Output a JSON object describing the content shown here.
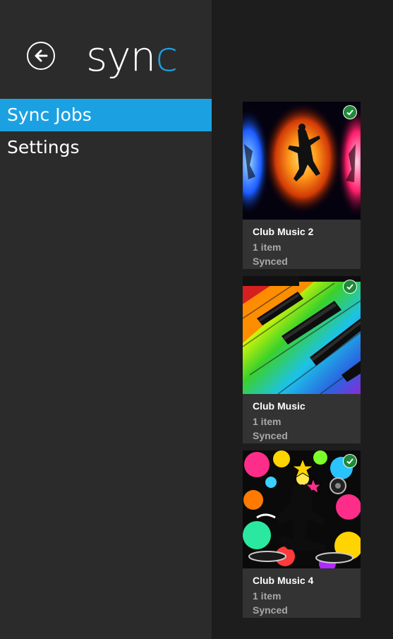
{
  "header": {
    "back_icon": "back-arrow-icon",
    "title_main": "syn",
    "title_accent": "c"
  },
  "nav": {
    "items": [
      {
        "label": "Sync Jobs",
        "selected": true
      },
      {
        "label": "Settings",
        "selected": false
      }
    ]
  },
  "jobs": [
    {
      "title": "Club Music 2",
      "count": "1 item",
      "status": "Synced",
      "image": "dancer-fire-image",
      "badge": "check-icon"
    },
    {
      "title": "Club Music",
      "count": "1 item",
      "status": "Synced",
      "image": "rainbow-piano-keys-image",
      "badge": "check-icon"
    },
    {
      "title": "Club Music 4",
      "count": "1 item",
      "status": "Synced",
      "image": "dj-silhouette-image",
      "badge": "check-icon"
    }
  ],
  "colors": {
    "accent": "#1ba1e2",
    "sidebar_bg": "#2b2b2b",
    "content_bg": "#1d1d1d",
    "tile_bg": "#333333",
    "badge_green": "#1e8a3a"
  }
}
